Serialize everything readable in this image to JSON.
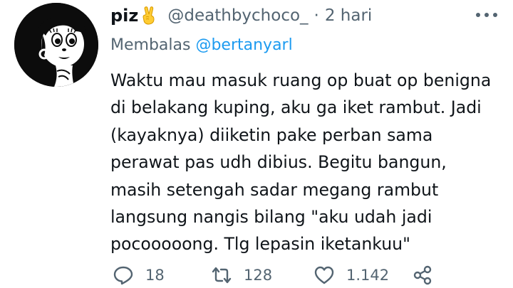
{
  "author": {
    "display_name": "piz",
    "emoji": "victory-hand-icon",
    "handle": "@deathbychoco_",
    "separator": "·",
    "time": "2 hari"
  },
  "reply": {
    "prefix": "Membalas",
    "target": "@bertanyarl"
  },
  "tweet": {
    "lines": [
      "Waktu mau masuk ruang op buat op benigna",
      "di belakang kuping, aku ga iket rambut. Jadi",
      "(kayaknya) diiketin pake perban sama",
      "perawat pas udh dibius. Begitu bangun,",
      "masih setengah sadar megang rambut",
      "langsung nangis bilang \"aku udah jadi",
      "pocooooong. Tlg lepasin iketankuu\""
    ]
  },
  "actions": {
    "reply_count": "18",
    "retweet_count": "128",
    "like_count": "1.142"
  },
  "colors": {
    "text_primary": "#0f1419",
    "text_secondary": "#536471",
    "link": "#1d9bf0",
    "background": "#ffffff"
  }
}
